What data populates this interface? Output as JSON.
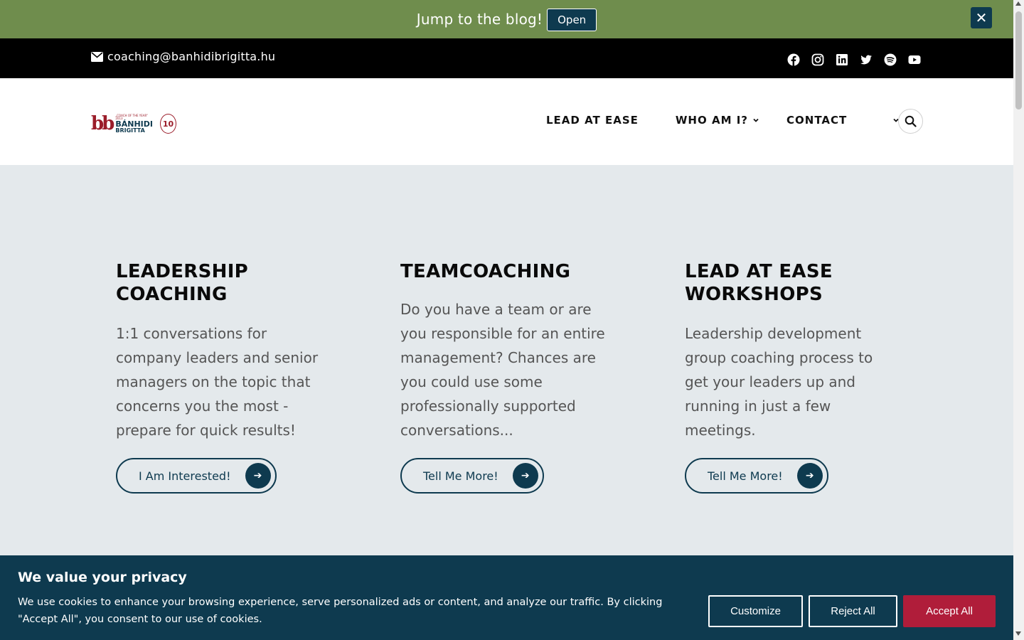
{
  "notice": {
    "text": "Jump to the blog!",
    "open_label": "Open",
    "close_label": "✕"
  },
  "contact": {
    "email": "coaching@banhidibrigitta.hu"
  },
  "socials": [
    "facebook-icon",
    "instagram-icon",
    "linkedin-icon",
    "twitter-icon",
    "spotify-icon",
    "youtube-icon"
  ],
  "logo": {
    "tagline": "„COACH OF THE YEAR” 2013",
    "name": "BÁNHIDI",
    "sub": "BRIGITTA",
    "badge": "10"
  },
  "nav": {
    "items": [
      {
        "label": "LEAD AT EASE"
      },
      {
        "label": "WHO AM I?"
      },
      {
        "label": "CONTACT"
      }
    ]
  },
  "cards": [
    {
      "title": "LEADERSHIP COACHING",
      "text": "1:1 conversations for company leaders and senior managers on the topic that concerns you the most - prepare for quick results!",
      "button": "I Am Interested!"
    },
    {
      "title": "TEAMCOACHING",
      "text": "Do you have a team or are you responsible for an entire management? Chances are you could use some professionally supported conversations...",
      "button": "Tell Me More!"
    },
    {
      "title": "LEAD AT EASE WORKSHOPS",
      "text": "Leadership development group coaching process to get your leaders up and running in just a few meetings.",
      "button": "Tell Me More!"
    }
  ],
  "cookie": {
    "title": "We value your privacy",
    "text": "We use cookies to enhance your browsing experience, serve personalized ads or content, and analyze our traffic. By clicking \"Accept All\", you consent to our use of cookies.",
    "customize": "Customize",
    "reject": "Reject All",
    "accept": "Accept All"
  },
  "colors": {
    "notice_bg": "#6f8d4d",
    "brand_dark": "#0e3a4f",
    "brand_red": "#9b1d2a",
    "accept_bg": "#b01d3a",
    "content_bg": "#e4e9ec"
  }
}
